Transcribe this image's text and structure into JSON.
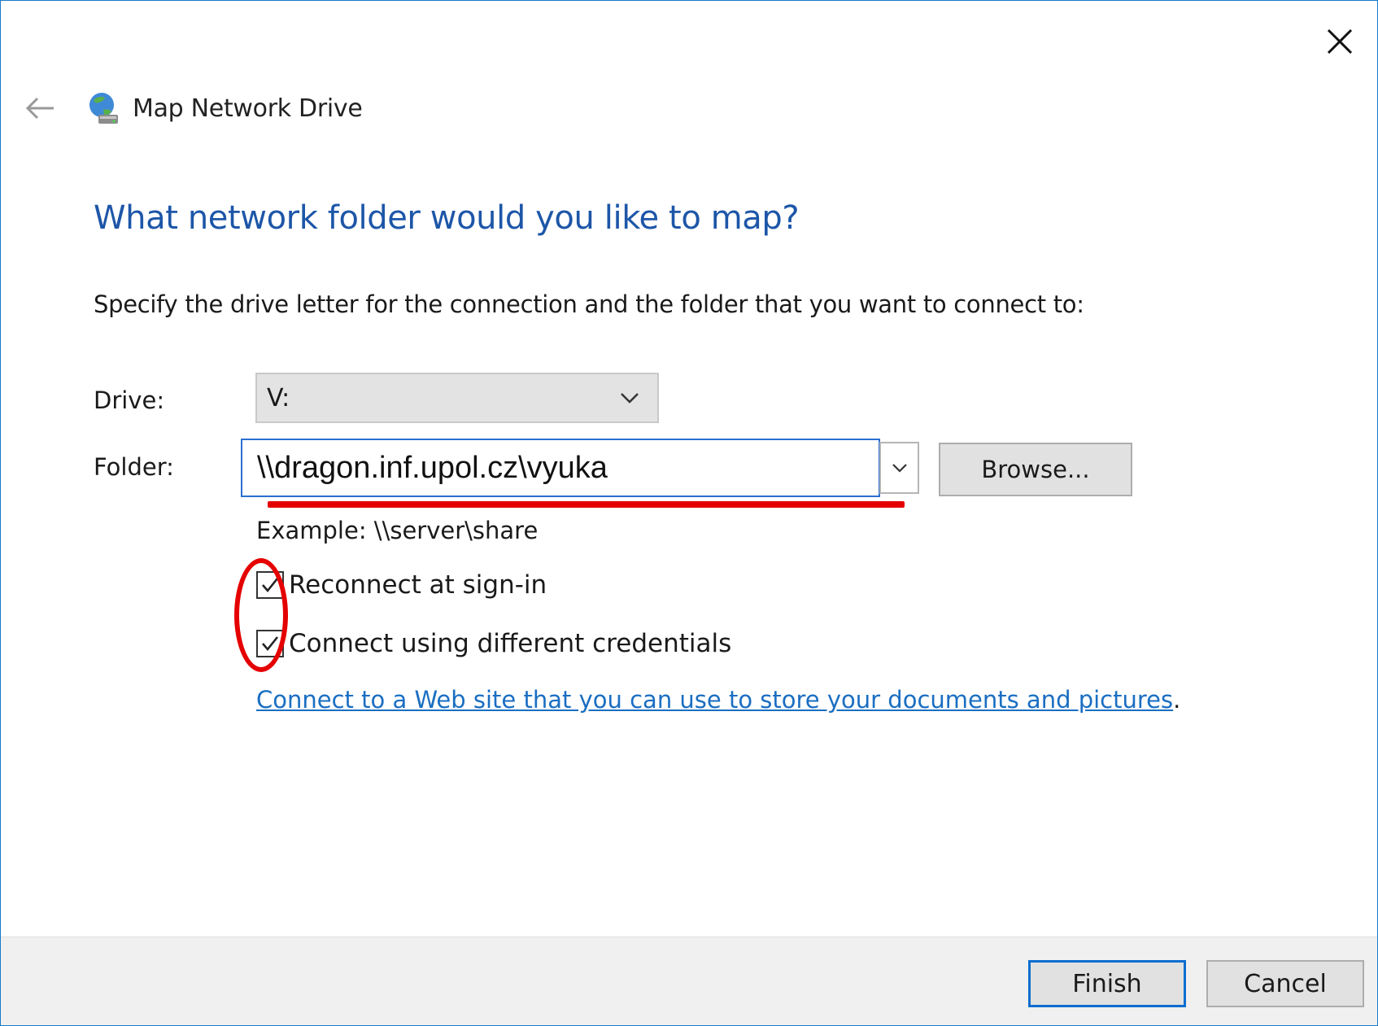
{
  "window": {
    "title": "Map Network Drive",
    "close_icon": "close-icon",
    "back_icon": "back-arrow-icon",
    "app_icon": "network-drive-icon"
  },
  "main": {
    "heading": "What network folder would you like to map?",
    "instruction": "Specify the drive letter for the connection and the folder that you want to connect to:",
    "drive": {
      "label": "Drive:",
      "value": "V:"
    },
    "folder": {
      "label": "Folder:",
      "value": "\\\\dragon.inf.upol.cz\\vyuka",
      "browse_label": "Browse..."
    },
    "example": "Example: \\\\server\\share",
    "options": [
      {
        "label": "Reconnect at sign-in",
        "checked": true
      },
      {
        "label": "Connect using different credentials",
        "checked": true
      }
    ],
    "web_link": {
      "text": "Connect to a Web site that you can use to store your documents and pictures",
      "suffix": "."
    }
  },
  "footer": {
    "finish_label": "Finish",
    "cancel_label": "Cancel"
  },
  "colors": {
    "heading": "#1d56a8",
    "link": "#1a6ec2",
    "accent_border": "#1979ca",
    "annotation": "#e50000"
  }
}
